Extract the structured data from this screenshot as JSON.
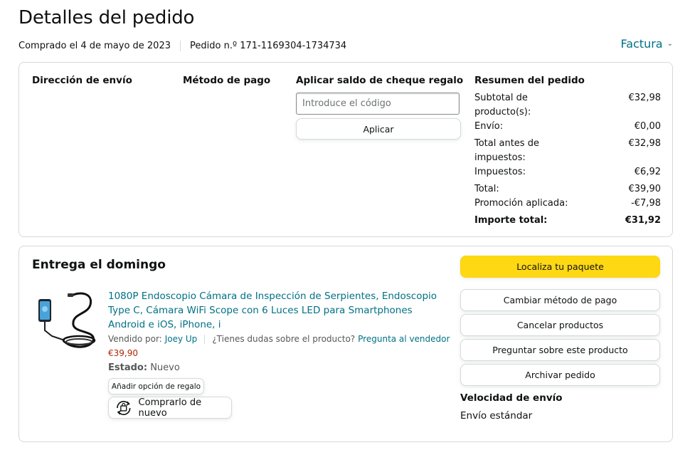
{
  "header": {
    "title": "Detalles del pedido",
    "purchased": "Comprado el 4 de mayo de 2023",
    "order_number": "Pedido n.º 171-1169304-1734734",
    "invoice_label": "Factura"
  },
  "summary_box": {
    "shipping_address_title": "Dirección de envío",
    "payment_method_title": "Método de pago",
    "gift_card_title": "Aplicar saldo de cheque regalo",
    "gift_card_placeholder": "Introduce el código",
    "apply_label": "Aplicar",
    "order_summary_title": "Resumen del pedido",
    "rows": [
      {
        "label": "Subtotal de producto(s):",
        "value": "€32,98"
      },
      {
        "label": "Envío:",
        "value": "€0,00"
      },
      {
        "label": "Total antes de impuestos:",
        "value": "€32,98"
      },
      {
        "label": "Impuestos:",
        "value": "€6,92"
      },
      {
        "label": "Total:",
        "value": "€39,90"
      },
      {
        "label": "Promoción aplicada:",
        "value": "-€7,98"
      },
      {
        "label": "Importe total:",
        "value": "€31,92"
      }
    ]
  },
  "delivery": {
    "title": "Entrega el domingo",
    "product_title": "1080P Endoscopio Cámara de Inspección de Serpientes, Endoscopio Type C, Cámara WiFi Scope con 6 Luces LED para Smartphones Android e iOS, iPhone, i",
    "sold_by_label": "Vendido por:",
    "seller": "Joey Up",
    "question_text": "¿Tienes dudas sobre el producto?",
    "ask_seller": "Pregunta al vendedor",
    "price": "€39,90",
    "condition_label": "Estado:",
    "condition_value": "Nuevo",
    "gift_option_label": "Añadir opción de regalo",
    "buy_again_label": "Comprarlo de nuevo",
    "buy_again_icon": "buy-again-icon"
  },
  "actions": {
    "track": "Localiza tu paquete",
    "change_payment": "Cambiar método de pago",
    "cancel": "Cancelar productos",
    "ask_product": "Preguntar sobre este producto",
    "archive": "Archivar pedido",
    "shipping_speed_title": "Velocidad de envío",
    "shipping_speed_value": "Envío estándar"
  },
  "colors": {
    "link": "#007185",
    "price": "#b12704",
    "primary_button": "#ffd814",
    "border": "#d5d9d9"
  }
}
